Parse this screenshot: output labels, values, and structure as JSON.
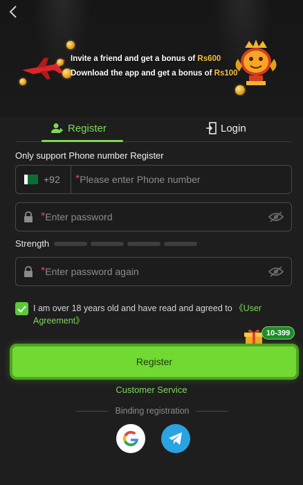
{
  "banner": {
    "line1_prefix": "Invite a friend and get a bonus of ",
    "line1_amount": "Rs600",
    "line2_prefix": "Download the app and get a bonus of ",
    "line2_amount": "Rs100"
  },
  "tabs": {
    "register": "Register",
    "login": "Login"
  },
  "form": {
    "section_label": "Only support Phone number Register",
    "country_code": "+92",
    "required_mark": "*",
    "phone_placeholder": "Please enter Phone number",
    "password_placeholder": "Enter password",
    "password_again_placeholder": "Enter password again",
    "strength_label": "Strength",
    "strength_level": 0,
    "agree_text": "I am over 18 years old and have read and agreed to ",
    "agree_link": "《User Agreement》",
    "agree_checked": true
  },
  "promo_badge": "10-399",
  "register_button": "Register",
  "customer_service": "Customer Service",
  "binding_label": "Binding registration",
  "colors": {
    "accent": "#7ed957",
    "button": "#72d932",
    "background": "#1e1e1e",
    "required": "#e04848",
    "amount": "#f5c542"
  },
  "icons": [
    "back-arrow-icon",
    "user-add-icon",
    "login-door-icon",
    "pakistan-flag-icon",
    "lock-icon",
    "eye-off-icon",
    "check-icon",
    "gift-icon",
    "google-icon",
    "telegram-icon",
    "plane-icon",
    "trophy-icon"
  ]
}
